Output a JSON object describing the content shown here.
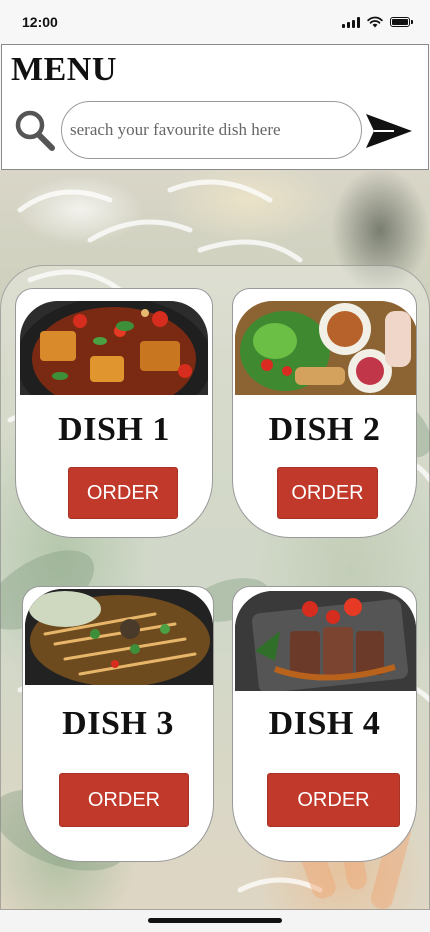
{
  "status_bar": {
    "time": "12:00"
  },
  "header": {
    "title": "MENU",
    "search_placeholder": "serach your favourite dish here",
    "search_value": ""
  },
  "icons": {
    "search": "search-icon",
    "send": "send-icon",
    "signal": "signal-icon",
    "wifi": "wifi-icon",
    "battery": "battery-icon"
  },
  "colors": {
    "order_button": "#c0392b"
  },
  "dishes": [
    {
      "name": "DISH 1",
      "button": "ORDER"
    },
    {
      "name": "DISH 2",
      "button": "ORDER"
    },
    {
      "name": "DISH 3",
      "button": "ORDER"
    },
    {
      "name": "DISH 4",
      "button": "ORDER"
    }
  ]
}
